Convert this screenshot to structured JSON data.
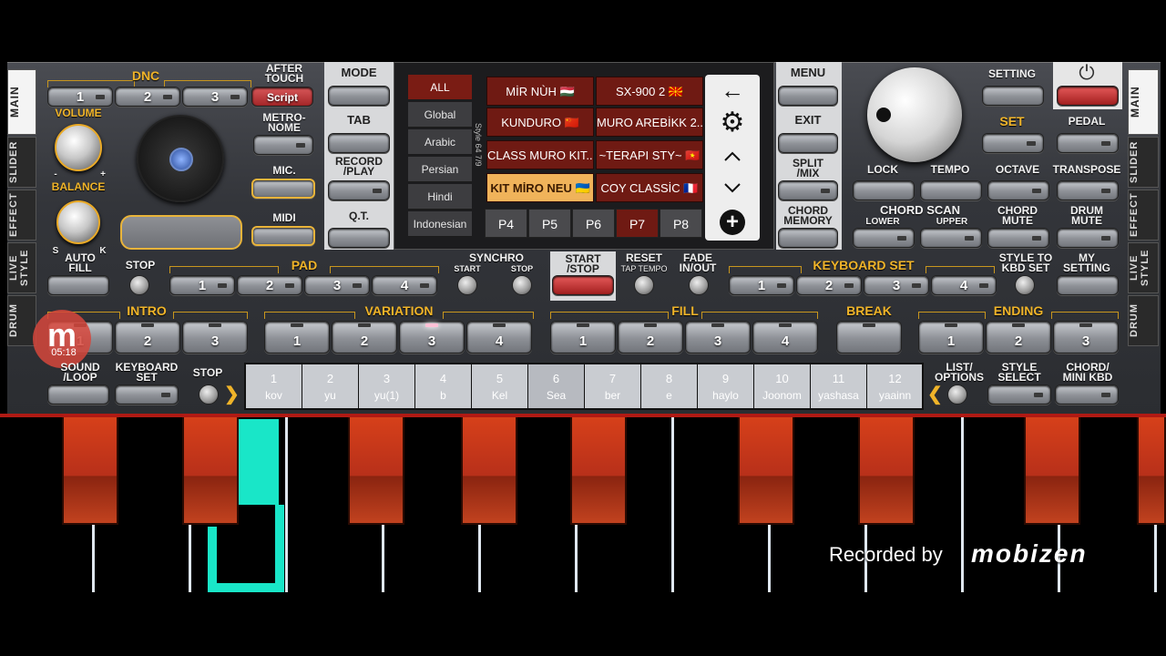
{
  "left_tabs": [
    "MAIN",
    "SLIDER",
    "EFFECT",
    "LIVE STYLE",
    "DRUM"
  ],
  "right_tabs": [
    "MAIN",
    "SLIDER",
    "EFFECT",
    "LIVE STYLE",
    "DRUM"
  ],
  "dnc": {
    "label": "DNC",
    "buttons": [
      "1",
      "2",
      "3"
    ],
    "script": "Script"
  },
  "after_touch": "AFTER\nTOUCH",
  "volume": "VOLUME",
  "balance": "BALANCE",
  "knob_marks": {
    "minus": "-",
    "plus": "+",
    "s": "S",
    "k": "K"
  },
  "mode": "MODE",
  "tab": "TAB",
  "record_play": "RECORD\n/PLAY",
  "qt": "Q.T.",
  "metronome": "METRO-\nNOME",
  "mic": "MIC.",
  "midi": "MIDI",
  "categories": [
    "ALL",
    "Global",
    "Arabic",
    "Persian",
    "Hindi",
    "Indonesian"
  ],
  "style_strip": "Style 64 7/9",
  "styles": [
    "MİR NÙH 🇭🇺",
    "SX-900 2 🇲🇰",
    "KUNDURO 🇨🇳",
    "MURO AREBİKK 2...",
    "CLASS MURO KIT...",
    "~TERAPI STY~ 🇻🇳",
    "KIT MİRO NEU 🇺🇦",
    "COY CLASSİC 🇫🇷"
  ],
  "pages": [
    "P4",
    "P5",
    "P6",
    "P7",
    "P8"
  ],
  "menu": "MENU",
  "exit": "EXIT",
  "split_mix": "SPLIT\n/MIX",
  "chord_memory": "CHORD\nMEMORY",
  "setting": "SETTING",
  "set": "SET",
  "pedal": "PEDAL",
  "lock": "LOCK",
  "tempo": "TEMPO",
  "octave": "OCTAVE",
  "transpose": "TRANSPOSE",
  "chord_scan": "CHORD SCAN",
  "lower": "LOWER",
  "upper": "UPPER",
  "chord_mute": "CHORD\nMUTE",
  "drum_mute": "DRUM\nMUTE",
  "auto_fill": "AUTO\nFILL",
  "stop": "STOP",
  "pad": {
    "label": "PAD",
    "buttons": [
      "1",
      "2",
      "3",
      "4"
    ]
  },
  "synchro": "SYNCHRO",
  "synchro_start": "START",
  "synchro_stop": "STOP",
  "start_stop": "START\n/STOP",
  "reset": "RESET",
  "tap_tempo": "TAP TEMPO",
  "fade": "FADE\nIN/OUT",
  "keyboard_set": {
    "label": "KEYBOARD SET",
    "buttons": [
      "1",
      "2",
      "3",
      "4"
    ]
  },
  "style_to_kbd": "STYLE TO\nKBD SET",
  "my_setting": "MY\nSETTING",
  "intro": {
    "label": "INTRO",
    "buttons": [
      "1",
      "2",
      "3"
    ]
  },
  "variation": {
    "label": "VARIATION",
    "buttons": [
      "1",
      "2",
      "3",
      "4"
    ]
  },
  "fill": {
    "label": "FILL",
    "buttons": [
      "1",
      "2",
      "3",
      "4"
    ]
  },
  "break": "BREAK",
  "ending": {
    "label": "ENDING",
    "buttons": [
      "1",
      "2",
      "3"
    ]
  },
  "sound_loop": "SOUND\n/LOOP",
  "kbd_set": "KEYBOARD\nSET",
  "stop2": "STOP",
  "registrations": [
    {
      "n": "1",
      "t": "kov"
    },
    {
      "n": "2",
      "t": "yu"
    },
    {
      "n": "3",
      "t": "yu(1)"
    },
    {
      "n": "4",
      "t": "b"
    },
    {
      "n": "5",
      "t": "Kel"
    },
    {
      "n": "6",
      "t": "Sea"
    },
    {
      "n": "7",
      "t": "ber"
    },
    {
      "n": "8",
      "t": "e"
    },
    {
      "n": "9",
      "t": "haylo"
    },
    {
      "n": "10",
      "t": "Joonom"
    },
    {
      "n": "11",
      "t": "yashasa"
    },
    {
      "n": "12",
      "t": "yaainn"
    }
  ],
  "list_options": "LIST/\nOPTIONS",
  "style_select": "STYLE\nSELECT",
  "chord_mini": "CHORD/\nMINI KBD",
  "rec_time": "05:18",
  "recorded_by": "Recorded by",
  "recorder_brand": "mobizen",
  "colors": {
    "accent": "#f0b429",
    "style_bg": "#6f1a13",
    "key_red": "#c83a1c",
    "teal": "#19e6c8"
  }
}
